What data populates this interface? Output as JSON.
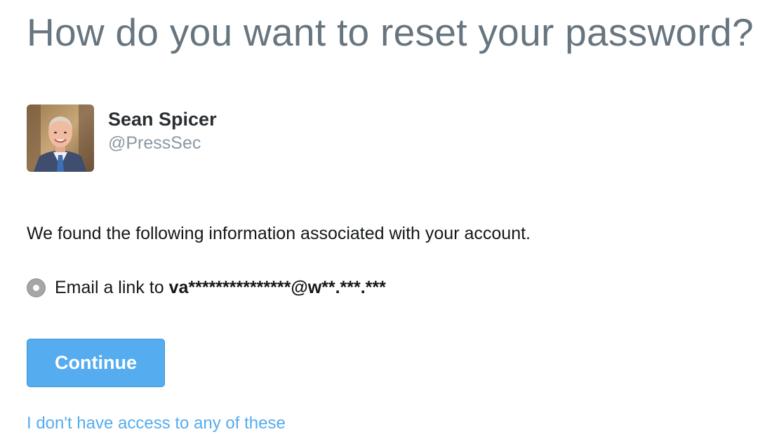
{
  "page": {
    "title": "How do you want to reset your password?"
  },
  "account": {
    "name": "Sean Spicer",
    "handle": "@PressSec",
    "avatar_icon": "profile-photo"
  },
  "info_text": "We found the following information associated with your account.",
  "options": [
    {
      "label_prefix": "Email a link to",
      "masked_email": "va***************@w**.***.***",
      "selected": true
    }
  ],
  "buttons": {
    "continue_label": "Continue"
  },
  "links": {
    "no_access": "I don't have access to any of these"
  },
  "colors": {
    "title": "#66757f",
    "handle": "#8899a6",
    "button_bg": "#55acee",
    "link": "#55acee",
    "radio": "#a6a6a6"
  }
}
